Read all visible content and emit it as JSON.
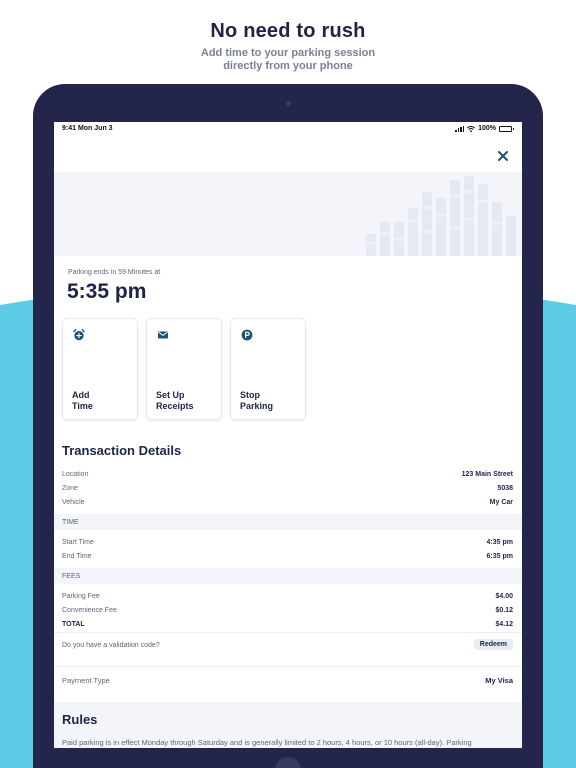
{
  "promo": {
    "headline": "No need to rush",
    "subhead_line1": "Add time to your parking session",
    "subhead_line2": "directly from your phone"
  },
  "colors": {
    "navy": "#23264a",
    "cyan": "#5dcbe5",
    "teal_icon": "#16566a",
    "panel": "#f4f5fa"
  },
  "status_bar": {
    "time": "9:41 Mon Jun 3",
    "battery": "100%"
  },
  "close_icon": "close-icon",
  "session": {
    "ends_label": "Parking ends in 59 Minutes at",
    "end_time": "5:35 pm"
  },
  "actions": [
    {
      "icon": "alarm-clock-icon",
      "line1": "Add",
      "line2": "Time"
    },
    {
      "icon": "envelope-icon",
      "line1": "Set Up",
      "line2": "Receipts"
    },
    {
      "icon": "parking-icon",
      "line1": "Stop",
      "line2": "Parking"
    }
  ],
  "transaction": {
    "title": "Transaction Details",
    "location_label": "Location",
    "location_value": "123 Main Street",
    "zone_label": "Zone",
    "zone_value": "5038",
    "vehicle_label": "Vehicle",
    "vehicle_value": "My Car",
    "time_header": "TIME",
    "start_label": "Start Time",
    "start_value": "4:35 pm",
    "end_label": "End Time",
    "end_value": "6:35 pm",
    "fees_header": "FEES",
    "parking_fee_label": "Parking Fee",
    "parking_fee_value": "$4.00",
    "convenience_fee_label": "Convenience Fee",
    "convenience_fee_value": "$0.12",
    "total_label": "TOTAL",
    "total_value": "$4.12",
    "validation_question": "Do you have a validation code?",
    "redeem_label": "Redeem",
    "payment_label": "Payment Type",
    "payment_value": "My Visa"
  },
  "rules": {
    "title": "Rules",
    "text": "Paid parking is in effect Monday through Saturday and is generally limited to 2 hours, 4 hours, or 10 hours (all-day). Parking"
  }
}
